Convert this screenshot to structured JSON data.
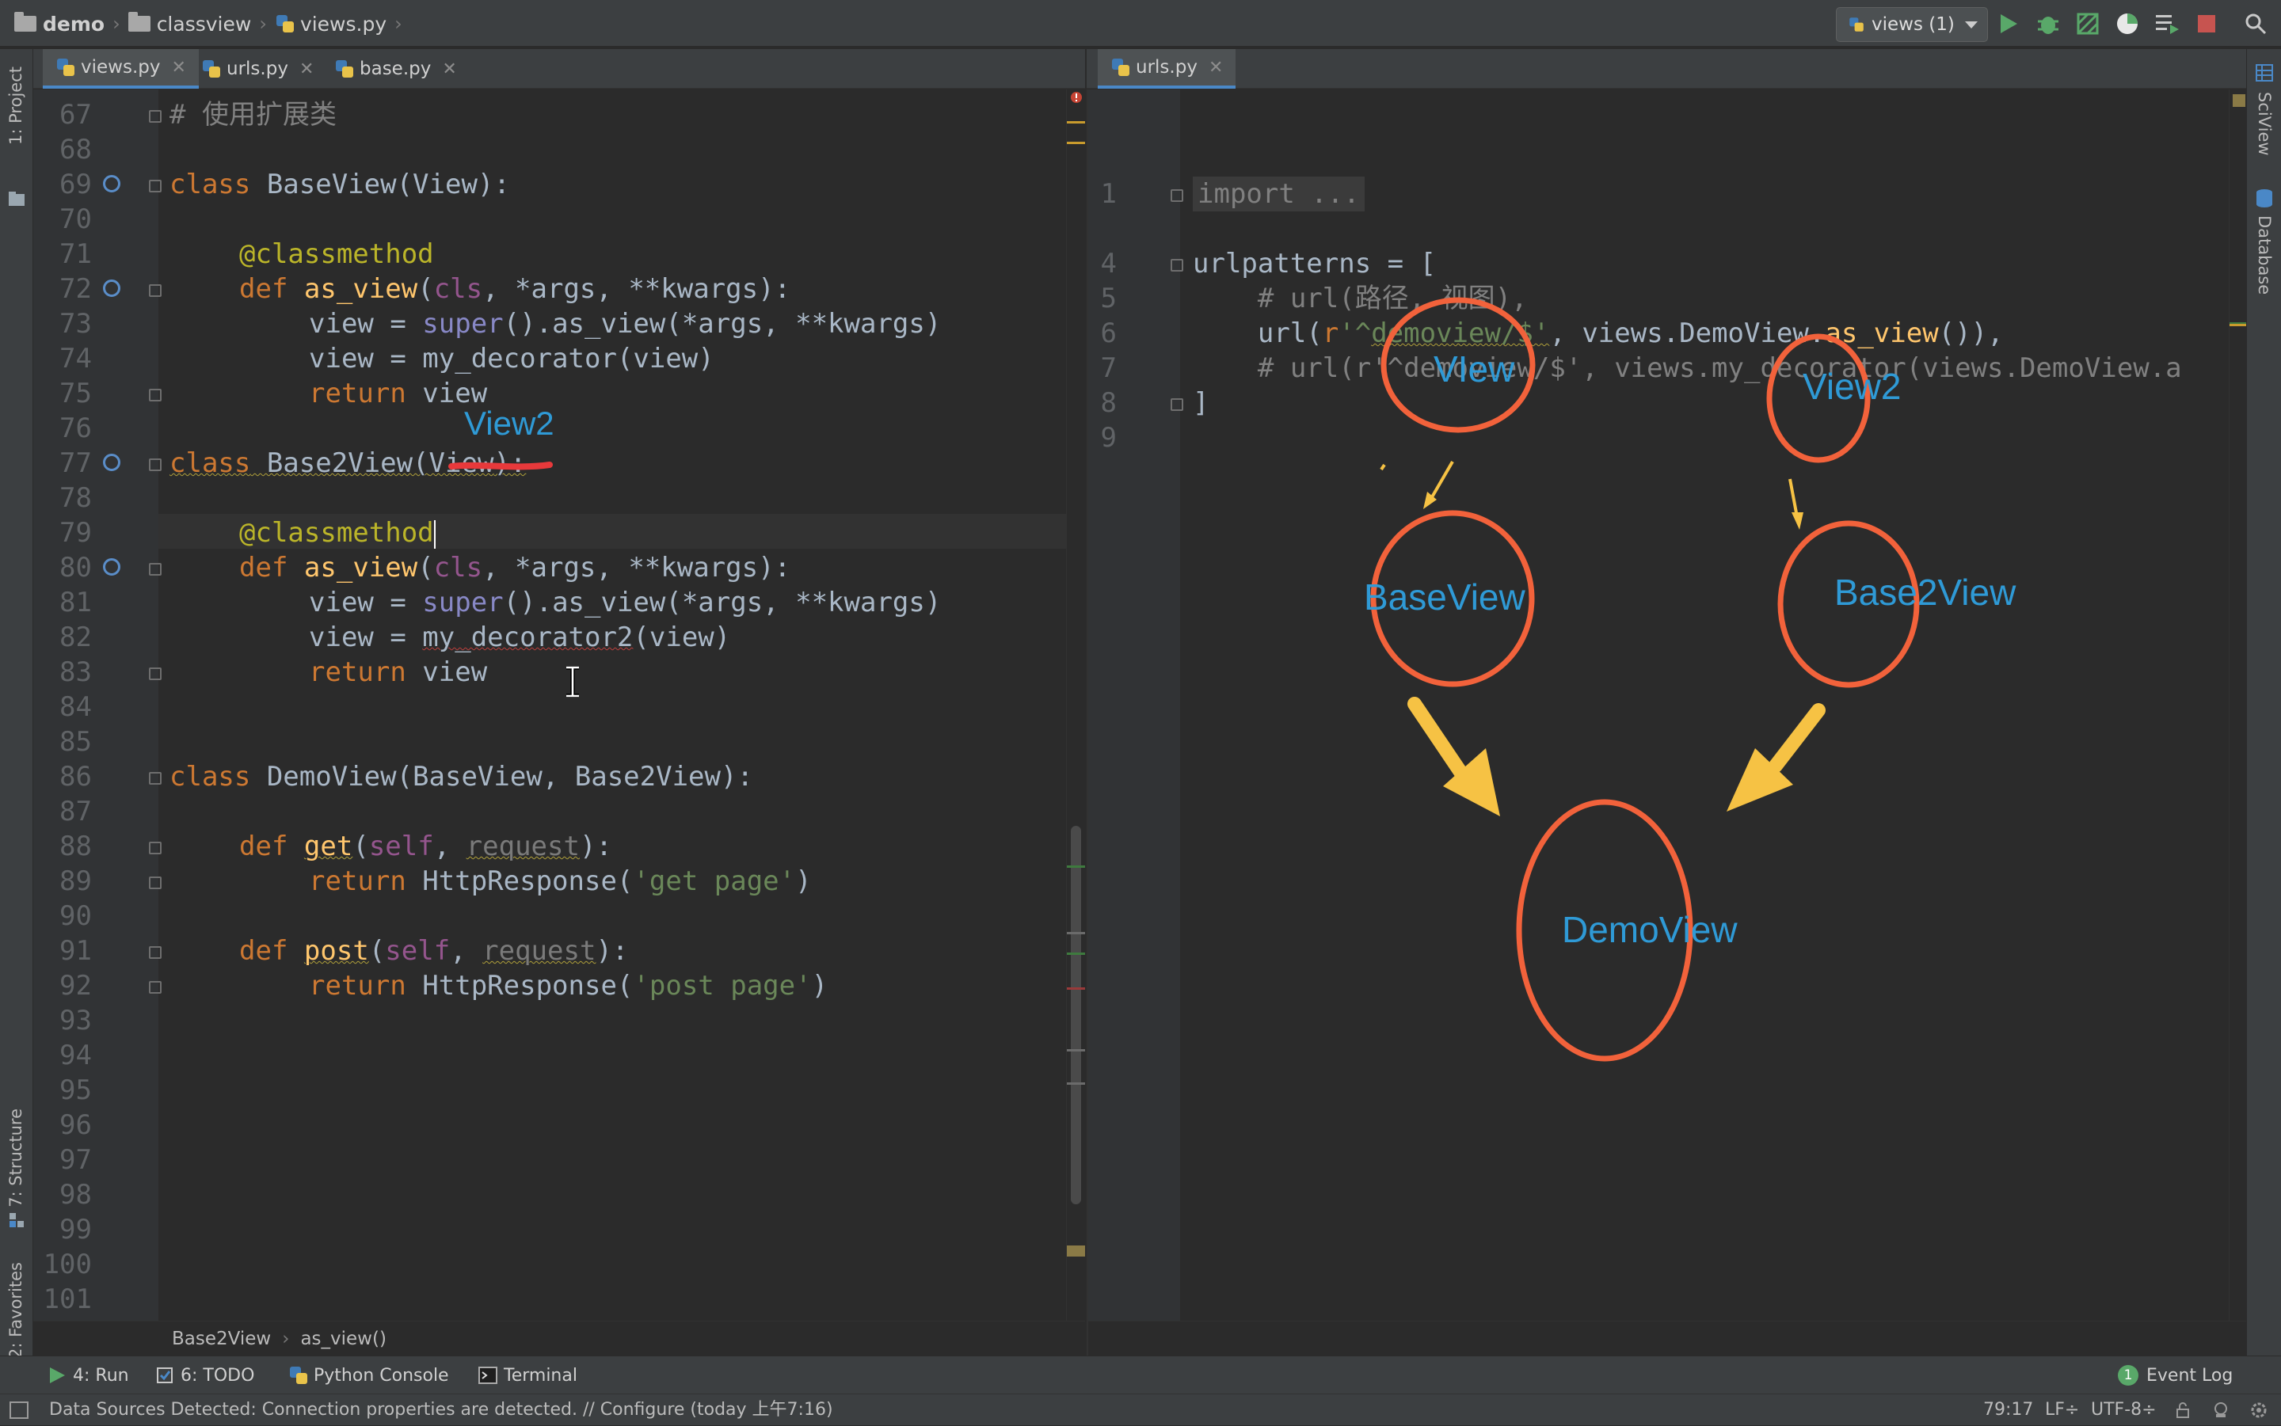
{
  "breadcrumb": {
    "project": "demo",
    "folder": "classview",
    "file": "views.py"
  },
  "run_config": {
    "label": "views (1)"
  },
  "left_tools": {
    "project": "1: Project",
    "structure": "7: Structure",
    "favorites": "2: Favorites"
  },
  "right_tools": {
    "sciview": "SciView",
    "database": "Database"
  },
  "left_editor": {
    "tabs": [
      {
        "label": "views.py",
        "active": true
      },
      {
        "label": "urls.py",
        "active": false
      },
      {
        "label": "base.py",
        "active": false
      }
    ],
    "line_numbers": [
      "67",
      "68",
      "69",
      "70",
      "71",
      "72",
      "73",
      "74",
      "75",
      "76",
      "77",
      "78",
      "79",
      "80",
      "81",
      "82",
      "83",
      "84",
      "85",
      "86",
      "87",
      "88",
      "89",
      "90",
      "91",
      "92",
      "93",
      "94",
      "95",
      "96",
      "97",
      "98",
      "99",
      "100",
      "101"
    ],
    "lines": {
      "l67": "# 使用扩展类",
      "l69_kw": "class",
      "l69_rest": " BaseView(View):",
      "l71": "@classmethod",
      "l72_kw": "def",
      "l72_fn": "as_view",
      "l72_a": "(",
      "l72_cls": "cls",
      "l72_rest": ", *args, **kwargs):",
      "l73_a": "view = ",
      "l73_bi": "super",
      "l73_rest": "().as_view(*args, **kwargs)",
      "l74": "view = my_decorator(view)",
      "l75_kw": "return",
      "l75_rest": " view",
      "l77_kw": "class",
      "l77_name": " Base2View(",
      "l77_base": "View",
      "l77_end": "):",
      "l79": "@classmethod",
      "l80_kw": "def",
      "l80_fn": "as_view",
      "l80_a": "(",
      "l80_cls": "cls",
      "l80_rest": ", *args, **kwargs):",
      "l81_a": "view = ",
      "l81_bi": "super",
      "l81_rest": "().as_view(*args, **kwargs)",
      "l82_a": "view = ",
      "l82_fn": "my_decorator2",
      "l82_rest": "(view)",
      "l83_kw": "return",
      "l83_rest": " view",
      "l86_kw": "class",
      "l86_rest": " DemoView(BaseView, Base2View):",
      "l88_kw": "def",
      "l88_fn": "get",
      "l88_a": "(",
      "l88_self": "self",
      "l88_b": ", ",
      "l88_req": "request",
      "l88_end": "):",
      "l89_kw": "return",
      "l89_a": " HttpResponse(",
      "l89_str": "'get page'",
      "l89_end": ")",
      "l91_kw": "def",
      "l91_fn": "post",
      "l91_a": "(",
      "l91_self": "self",
      "l91_b": ", ",
      "l91_req": "request",
      "l91_end": "):",
      "l92_kw": "return",
      "l92_a": " HttpResponse(",
      "l92_str": "'post page'",
      "l92_end": ")"
    },
    "breadcrumb": {
      "cls": "Base2View",
      "method": "as_view()"
    }
  },
  "right_editor": {
    "tabs": [
      {
        "label": "urls.py",
        "active": true
      }
    ],
    "line_numbers": [
      "1",
      "4",
      "5",
      "6",
      "7",
      "8",
      "9"
    ],
    "lines": {
      "l1": "import ...",
      "l5": "urlpatterns = [",
      "l6": "    # url(路径, 视图),",
      "l7_a": "    url(",
      "l7_r": "r",
      "l7_str1": "'^",
      "l7_mid": "demoview/$'",
      "l7_b": ", views.DemoView.",
      "l7_fn": "as_view",
      "l7_end": "()),",
      "l8": "    # url(r'^demoview/$', views.my_decorator(views.DemoView.a",
      "l9": "]"
    }
  },
  "annotations": {
    "inline_view2": "View2",
    "view": "VIew",
    "view2": "View2",
    "baseview": "BaseView",
    "base2view": "Base2View",
    "demoview": "DemoView"
  },
  "bottom_tools": {
    "run": "4: Run",
    "todo": "6: TODO",
    "console": "Python Console",
    "terminal": "Terminal",
    "event_log": "Event Log",
    "event_count": "1"
  },
  "status": {
    "message": "Data Sources Detected: Connection properties are detected. // Configure (today 上午7:16)",
    "position": "79:17",
    "line_sep": "LF÷",
    "encoding": "UTF-8÷"
  },
  "colors": {
    "annotation_circle": "#f2623b",
    "annotation_arrow": "#f6c244",
    "annotation_text": "#2f9ad6"
  }
}
